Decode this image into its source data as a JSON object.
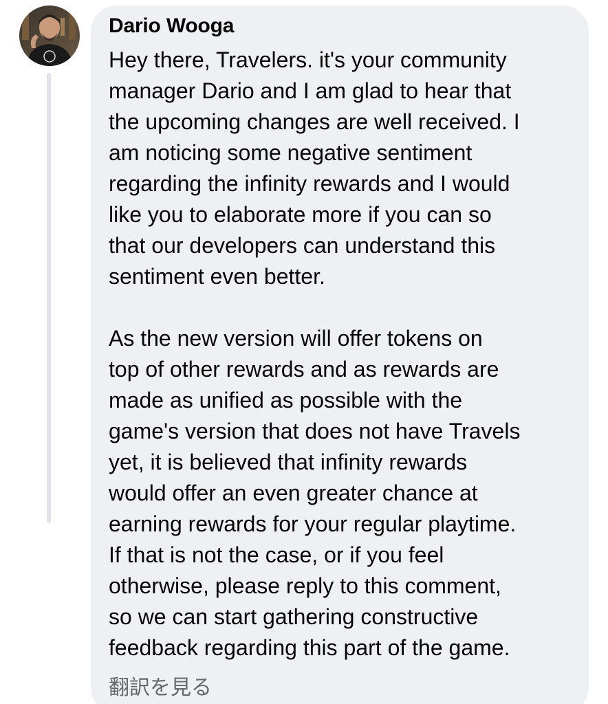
{
  "comment": {
    "author": "Dario Wooga",
    "avatar_icon": "profile-photo",
    "paragraphs": [
      [
        "Hey there, Travelers. it's your community",
        "manager Dario and I am glad to hear that",
        "the upcoming changes are well received. I",
        "am noticing some negative sentiment",
        "regarding the infinity rewards and I would",
        "like you to elaborate more if you can so",
        "that our developers can understand this",
        "sentiment even better."
      ],
      [
        "As the new version will offer tokens on",
        "top of other rewards and as rewards are",
        "made as unified as possible with the",
        "game's version that does not have Travels",
        "yet, it is believed that infinity rewards",
        "would offer an even greater chance at",
        "earning rewards for your regular playtime.",
        "If that is not the case, or if you feel",
        "otherwise, please reply to this comment,",
        "so we can start gathering constructive",
        "feedback regarding this part of the game."
      ]
    ],
    "translate_label": "翻訳を見る"
  },
  "colors": {
    "bubble_background": "#eef0f3",
    "text": "#050505",
    "secondary_text": "#65676b",
    "thread_line": "#e1e3e8"
  }
}
